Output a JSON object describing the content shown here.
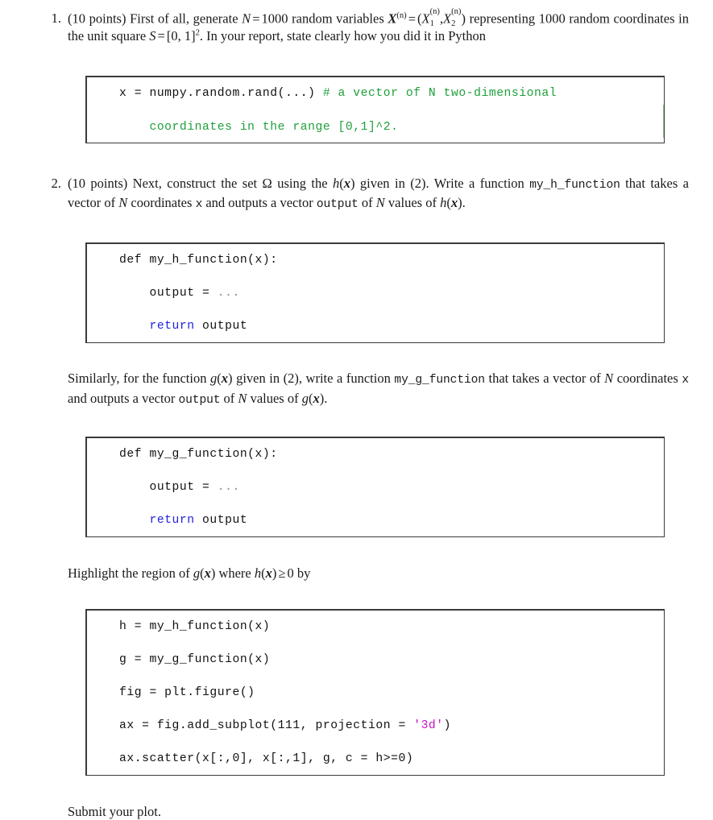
{
  "document": {
    "kind": "latex-homework-assignment"
  },
  "problems": [
    {
      "number": "1.",
      "points_label": "(10 points)",
      "text_segments": {
        "s1": "First of all, generate ",
        "var_N": "N",
        "eq1": "=",
        "val_N": "1000",
        "s2": " random variables ",
        "vec_X": "X",
        "sup_n": "(n)",
        "eq2": "=",
        "open_paren": "(",
        "X1": "X",
        "X1_sub": "1",
        "X1_sup": "(n)",
        "comma": ",",
        "X2": "X",
        "X2_sub": "2",
        "X2_sup": "(n)",
        "close_paren": ")",
        "s3": " representing 1000 random coordinates in the unit square ",
        "var_S": "S",
        "eq3": "=",
        "interval": "[0, 1]",
        "interval_sup": "2",
        "s4": ". In your report, state clearly how you did it in Python"
      },
      "code": {
        "lines": [
          [
            {
              "t": "x = numpy.random.rand(...) ",
              "c": "plain"
            },
            {
              "t": "# a vector of N two-dimensional",
              "c": "comment"
            }
          ],
          [
            {
              "t": "    coordinates in the range [0,1]^2.",
              "c": "comment"
            }
          ]
        ]
      }
    },
    {
      "number": "2.",
      "points_label": "(10 points)",
      "text_segments": {
        "s1": "Next, construct the set ",
        "omega": "Ω",
        "s2": " using the ",
        "h": "h",
        "h_arg_open": "(",
        "h_arg": "x",
        "h_arg_close": ")",
        "s3": " given in (2). Write a function ",
        "fn_name": "my_h_function",
        "s4": " that takes a vector of ",
        "var_N": "N",
        "s5": " coordinates ",
        "arg_x": "x",
        "s6": " and outputs a vector ",
        "out_name": "output",
        "s7": " of ",
        "var_N2": "N",
        "s8": " values of ",
        "h2": "h",
        "h2_arg_open": "(",
        "h2_arg": "x",
        "h2_arg_close": ")",
        "s9": "."
      },
      "code": {
        "lines": [
          [
            {
              "t": "def my_h_function(x):",
              "c": "plain"
            }
          ],
          [
            {
              "t": "    output = ",
              "c": "plain"
            },
            {
              "t": "...",
              "c": "dim"
            }
          ],
          [
            {
              "t": "    ",
              "c": "plain"
            },
            {
              "t": "return",
              "c": "keyword"
            },
            {
              "t": " output",
              "c": "plain"
            }
          ]
        ]
      },
      "similarly_paragraph": {
        "s1": "Similarly, for the function ",
        "g": "g",
        "g_arg_open": "(",
        "g_arg": "x",
        "g_arg_close": ")",
        "s2": " given in (2), write a function ",
        "fn_name": "my_g_function",
        "s3": " that takes a vector of ",
        "var_N": "N",
        "s4": " coordinates ",
        "arg_x": "x",
        "s5": " and outputs a vector ",
        "out_name": "output",
        "s6": " of ",
        "var_N2": "N",
        "s7": " values of ",
        "g2": "g",
        "g2_arg_open": "(",
        "g2_arg": "x",
        "g2_arg_close": ")",
        "s8": "."
      },
      "code_g": {
        "lines": [
          [
            {
              "t": "def my_g_function(x):",
              "c": "plain"
            }
          ],
          [
            {
              "t": "    output = ",
              "c": "plain"
            },
            {
              "t": "...",
              "c": "dim"
            }
          ],
          [
            {
              "t": "    ",
              "c": "plain"
            },
            {
              "t": "return",
              "c": "keyword"
            },
            {
              "t": " output",
              "c": "plain"
            }
          ]
        ]
      },
      "highlight_paragraph": {
        "s1": "Highlight the region of ",
        "g": "g",
        "g_arg_open": "(",
        "g_arg": "x",
        "g_arg_close": ")",
        "s2": " where ",
        "h": "h",
        "h_arg_open": "(",
        "h_arg": "x",
        "h_arg_close": ")",
        "geq": "≥",
        "zero": "0",
        "s3": " by"
      },
      "code_plot": {
        "lines": [
          [
            {
              "t": "h = my_h_function(x)",
              "c": "plain"
            }
          ],
          [
            {
              "t": "g = my_g_function(x)",
              "c": "plain"
            }
          ],
          [
            {
              "t": "fig = plt.figure()",
              "c": "plain"
            }
          ],
          [
            {
              "t": "ax = fig.add_subplot(111, projection = ",
              "c": "plain"
            },
            {
              "t": "'3d'",
              "c": "string"
            },
            {
              "t": ")",
              "c": "plain"
            }
          ],
          [
            {
              "t": "ax.scatter(x[:,0], x[:,1], g, c = h>=0)",
              "c": "plain"
            }
          ]
        ]
      },
      "closing_line": "Submit your plot."
    }
  ],
  "colors": {
    "comment_green": "#1f9f3a",
    "keyword_blue": "#2222dd",
    "string_magenta": "#c315c3",
    "ellipsis_grey": "#8d8d8d",
    "box_border": "#3a3a3a",
    "text": "#1a1a1a",
    "page_background": "#ffffff"
  }
}
